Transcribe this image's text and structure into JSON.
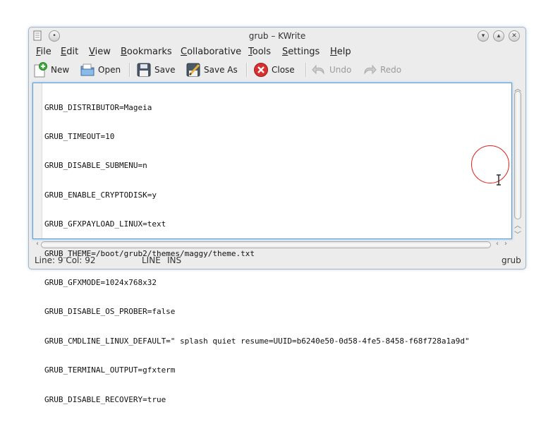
{
  "window": {
    "title": "grub – KWrite",
    "controls": [
      "minimize-icon",
      "maximize-icon",
      "close-icon"
    ]
  },
  "menubar": {
    "items": [
      {
        "label": "File",
        "u": "F",
        "rest": "ile"
      },
      {
        "label": "Edit",
        "u": "E",
        "rest": "dit"
      },
      {
        "label": "View",
        "u": "V",
        "rest": "iew"
      },
      {
        "label": "Bookmarks",
        "u": "B",
        "rest": "ookmarks"
      },
      {
        "label": "Collaborative",
        "u": "C",
        "rest": "ollaborative"
      },
      {
        "label": "Tools",
        "u": "T",
        "rest": "ools"
      },
      {
        "label": "Settings",
        "u": "S",
        "rest": "ettings"
      },
      {
        "label": "Help",
        "u": "H",
        "rest": "elp"
      }
    ]
  },
  "toolbar": {
    "new": "New",
    "open": "Open",
    "save": "Save",
    "save_as": "Save As",
    "close": "Close",
    "undo": "Undo",
    "redo": "Redo"
  },
  "editor": {
    "lines": [
      "GRUB_DISTRIBUTOR=Mageia",
      "GRUB_TIMEOUT=10",
      "GRUB_DISABLE_SUBMENU=n",
      "GRUB_ENABLE_CRYPTODISK=y",
      "GRUB_GFXPAYLOAD_LINUX=text",
      "GRUB_THEME=/boot/grub2/themes/maggy/theme.txt",
      "GRUB_GFXMODE=1024x768x32",
      "GRUB_DISABLE_OS_PROBER=false",
      "GRUB_CMDLINE_LINUX_DEFAULT=\" splash quiet resume=UUID=b6240e50-0d58-4fe5-8458-f68f728a1a9d\"",
      "GRUB_TERMINAL_OUTPUT=gfxterm",
      "GRUB_DISABLE_RECOVERY=true"
    ]
  },
  "statusbar": {
    "position": "Line: 9 Col: 92",
    "mode_line": "LINE",
    "mode_ins": "INS",
    "filename": "grub"
  },
  "colors": {
    "focus_border": "#5aa0d8",
    "annotation": "#e02020"
  }
}
